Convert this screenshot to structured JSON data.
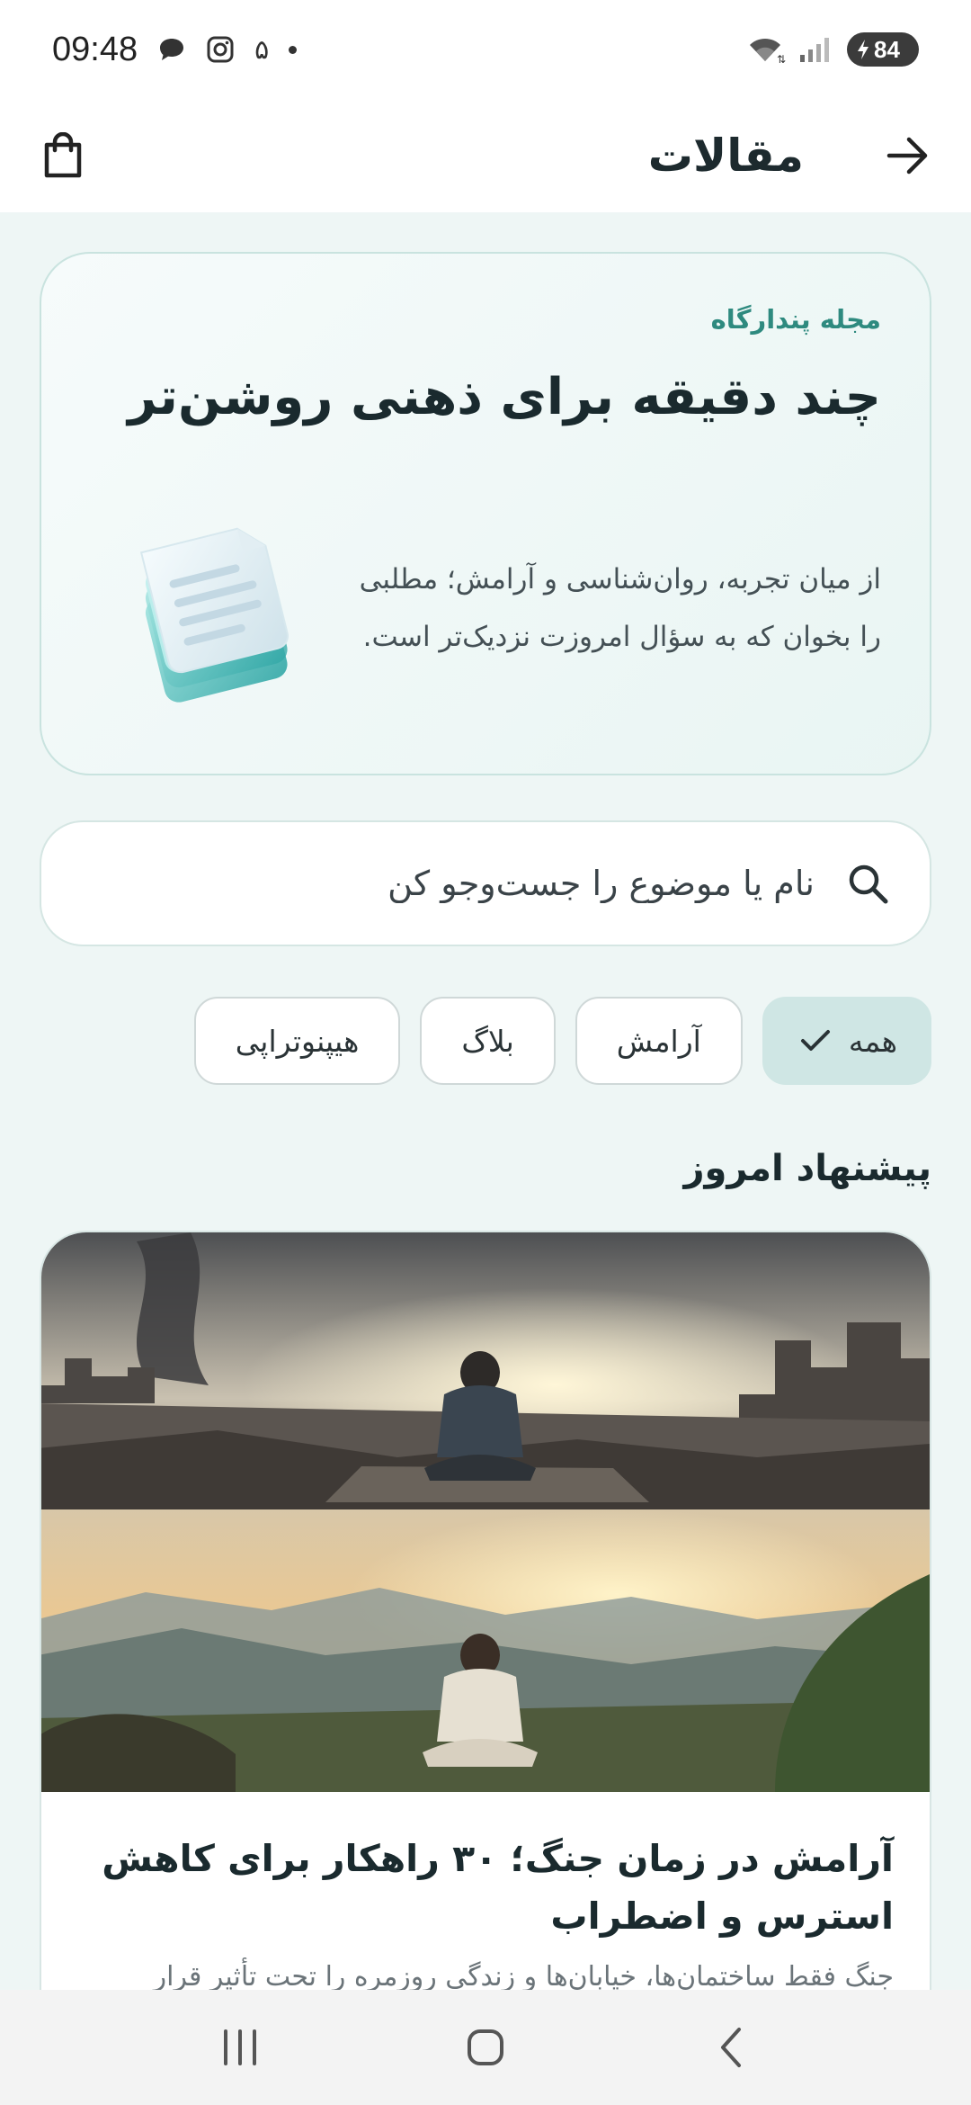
{
  "status_bar": {
    "time": "09:48",
    "notification_count": "۵",
    "battery": "84",
    "icons": [
      "chat-bubble-icon",
      "instagram-icon",
      "wifi-icon",
      "signal-icon",
      "battery-charging-icon"
    ]
  },
  "app_bar": {
    "title": "مقالات",
    "back_icon": "arrow-right-icon",
    "bag_icon": "shopping-bag-icon"
  },
  "hero": {
    "eyebrow": "مجله پندارگاه",
    "title": "چند دقیقه برای ذهنی روشن‌تر",
    "body": "از میان تجربه، روان‌شناسی و آرامش؛ مطلبی را بخوان که به سؤال امروزت نزدیک‌تر است."
  },
  "search": {
    "placeholder": "نام یا موضوع را جست‌وجو کن"
  },
  "filters": {
    "selected": "همه",
    "chips": [
      {
        "label": "همه",
        "active": true
      },
      {
        "label": "آرامش",
        "active": false
      },
      {
        "label": "بلاگ",
        "active": false
      },
      {
        "label": "هیپنوتراپی",
        "active": false
      }
    ]
  },
  "recommend": {
    "section_title": "پیشنهاد امروز",
    "article": {
      "title": "آرامش در زمان جنگ؛ ۳۰ راهکار برای کاهش استرس و اضطراب",
      "excerpt": "جنگ فقط ساختمان‌ها، خیابان‌ها و زندگی روزمره را تحت تأثیر قرار"
    }
  },
  "colors": {
    "accent": "#2e8a7f",
    "chip_active": "#cfe6e4",
    "background": "#eef6f5"
  }
}
